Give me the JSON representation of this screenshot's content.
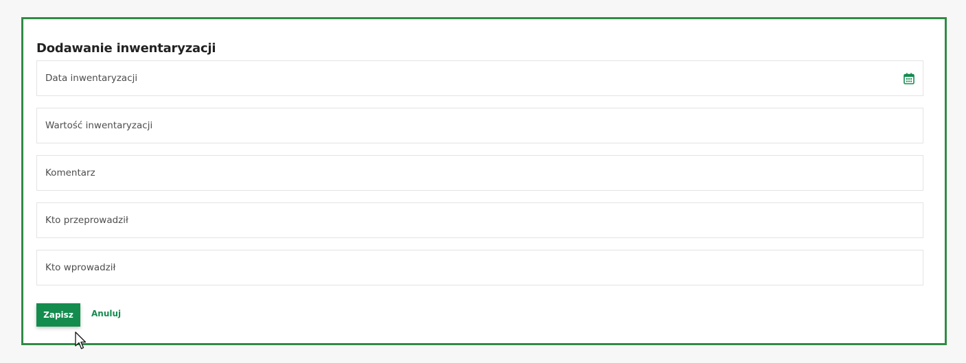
{
  "form": {
    "title": "Dodawanie inwentaryzacji",
    "fields": [
      {
        "label": "Data inwentaryzacji",
        "icon": "calendar-icon"
      },
      {
        "label": "Wartość inwentaryzacji"
      },
      {
        "label": "Komentarz"
      },
      {
        "label": "Kto przeprowadził"
      },
      {
        "label": "Kto wprowadził"
      }
    ],
    "save_label": "Zapisz",
    "cancel_label": "Anuluj"
  },
  "colors": {
    "accent": "#138c4e",
    "frame_border": "#2f8b45",
    "field_border": "#e3e3e3",
    "label_text": "#4d4d4d"
  }
}
